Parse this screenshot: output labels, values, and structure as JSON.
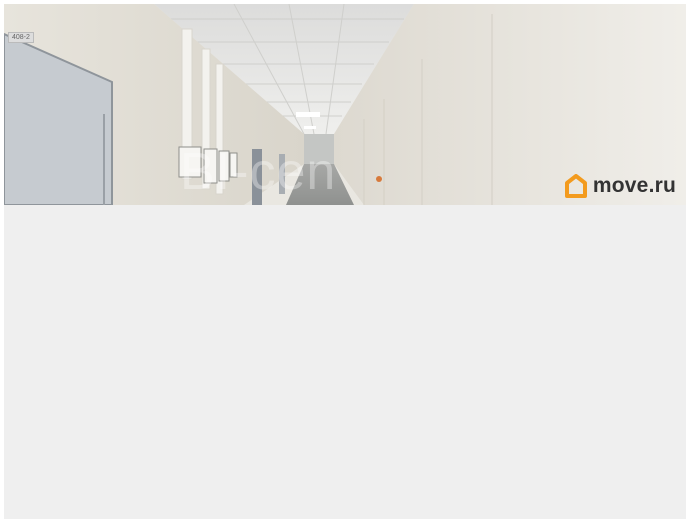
{
  "photo": {
    "watermark": "BI-cen",
    "door_sign": "408-2"
  },
  "brand": {
    "name": "move.ru",
    "icon": "house-icon",
    "accent": "#f39b1e"
  },
  "colors": {
    "background": "#efefef",
    "wall": "#ebe8e1",
    "ceiling": "#e6e6e4",
    "door": "#c6cbd0"
  }
}
